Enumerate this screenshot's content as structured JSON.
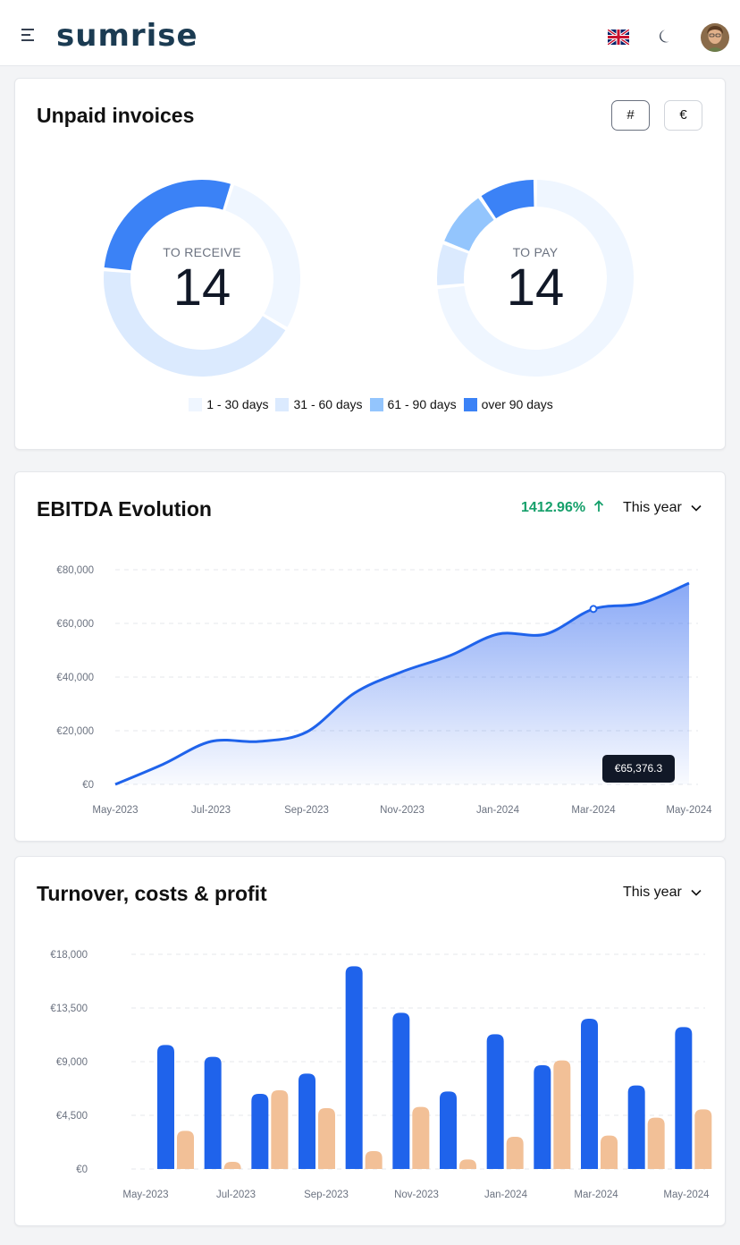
{
  "header": {
    "logo_text": "sumrise",
    "icons": [
      "menu-icon",
      "uk-flag-icon",
      "moon-icon",
      "avatar"
    ]
  },
  "unpaid_invoices": {
    "title": "Unpaid invoices",
    "toggle_count_label": "#",
    "toggle_amount_label": "€",
    "to_receive": {
      "label": "TO RECEIVE",
      "value": "14"
    },
    "to_pay": {
      "label": "TO PAY",
      "value": "14"
    },
    "legend": [
      {
        "label": "1 - 30 days",
        "color": "#eff6ff"
      },
      {
        "label": "31 - 60 days",
        "color": "#dbeafe"
      },
      {
        "label": "61 - 90 days",
        "color": "#93c5fd"
      },
      {
        "label": "over 90 days",
        "color": "#3b82f6"
      }
    ]
  },
  "ebitda": {
    "title": "EBITDA Evolution",
    "change": "1412.96%",
    "change_icon": "arrow-up-icon",
    "period": "This year",
    "tooltip": "€65,376.3"
  },
  "turnover": {
    "title": "Turnover, costs & profit",
    "period": "This year"
  },
  "chart_data": [
    {
      "type": "pie",
      "title": "TO RECEIVE",
      "center_value": "14",
      "categories": [
        "1 - 30 days",
        "31 - 60 days",
        "61 - 90 days",
        "over 90 days"
      ],
      "values": [
        4,
        6,
        0,
        4
      ],
      "colors": [
        "#eff6ff",
        "#dbeafe",
        "#93c5fd",
        "#3b82f6"
      ]
    },
    {
      "type": "pie",
      "title": "TO PAY",
      "center_value": "14",
      "categories": [
        "1 - 30 days",
        "31 - 60 days",
        "61 - 90 days",
        "over 90 days"
      ],
      "values": [
        10,
        1,
        1.3,
        1.3
      ],
      "colors": [
        "#eff6ff",
        "#dbeafe",
        "#93c5fd",
        "#3b82f6"
      ]
    },
    {
      "type": "area",
      "title": "EBITDA Evolution",
      "x": [
        "May-2023",
        "Jun-2023",
        "Jul-2023",
        "Aug-2023",
        "Sep-2023",
        "Oct-2023",
        "Nov-2023",
        "Dec-2023",
        "Jan-2024",
        "Feb-2024",
        "Mar-2024",
        "Apr-2024",
        "May-2024"
      ],
      "x_ticks": [
        "May-2023",
        "Jul-2023",
        "Sep-2023",
        "Nov-2023",
        "Jan-2024",
        "Mar-2024",
        "May-2024"
      ],
      "values": [
        0,
        7500,
        16000,
        16000,
        19500,
        34000,
        42000,
        48000,
        56000,
        56000,
        65376.3,
        67500,
        75000
      ],
      "y_ticks": [
        "€0",
        "€20,000",
        "€40,000",
        "€60,000",
        "€80,000"
      ],
      "ylim": [
        0,
        80000
      ],
      "grid": true,
      "color": "#1f63eb",
      "highlight_index": 10
    },
    {
      "type": "bar",
      "title": "Turnover, costs & profit",
      "categories": [
        "May-2023",
        "Jun-2023",
        "Jul-2023",
        "Aug-2023",
        "Sep-2023",
        "Oct-2023",
        "Nov-2023",
        "Dec-2023",
        "Jan-2024",
        "Feb-2024",
        "Mar-2024",
        "Apr-2024",
        "May-2024"
      ],
      "x_ticks": [
        "May-2023",
        "Jul-2023",
        "Sep-2023",
        "Nov-2023",
        "Jan-2024",
        "Mar-2024",
        "May-2024"
      ],
      "series": [
        {
          "color": "#1f63eb",
          "values": [
            10400,
            9400,
            6300,
            8000,
            17000,
            13100,
            6500,
            11300,
            8700,
            12600,
            7000,
            11900
          ]
        },
        {
          "color": "#f2c097",
          "values": [
            3200,
            600,
            6600,
            5100,
            1500,
            5200,
            800,
            2700,
            9100,
            2800,
            4300,
            5000
          ]
        }
      ],
      "y_ticks": [
        "€0",
        "€4,500",
        "€9,000",
        "€13,500",
        "€18,000"
      ],
      "ylim": [
        0,
        18000
      ],
      "grid": true
    }
  ]
}
